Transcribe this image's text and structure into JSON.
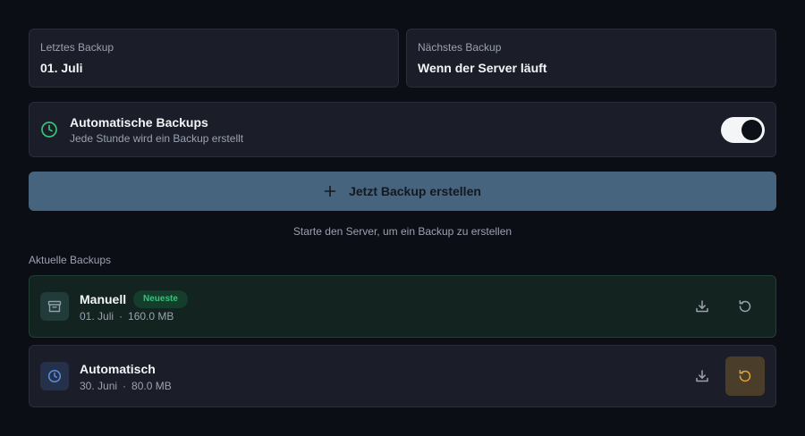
{
  "last_backup": {
    "label": "Letztes Backup",
    "value": "01. Juli"
  },
  "next_backup": {
    "label": "Nächstes Backup",
    "value": "Wenn der Server läuft"
  },
  "auto_backups": {
    "title": "Automatische Backups",
    "subtitle": "Jede Stunde wird ein Backup erstellt",
    "enabled": true,
    "icon": "clock-icon"
  },
  "create_button": {
    "label": "Jetzt Backup erstellen",
    "icon": "plus-icon"
  },
  "hint": "Starte den Server, um ein Backup zu erstellen",
  "section_label": "Aktuelle Backups",
  "backups": [
    {
      "title": "Manuell",
      "badge": "Neueste",
      "date": "01. Juli",
      "sep": "·",
      "size": "160.0 MB",
      "icon": "archive-icon"
    },
    {
      "title": "Automatisch",
      "badge": "",
      "date": "30. Juni",
      "sep": "·",
      "size": "80.0 MB",
      "icon": "clock-icon"
    }
  ],
  "colors": {
    "background": "#0c0e15",
    "card": "#1b1e28",
    "accent_green": "#37c27a",
    "primary_button": "#46647d",
    "restore_highlight": "#e0a43a"
  }
}
